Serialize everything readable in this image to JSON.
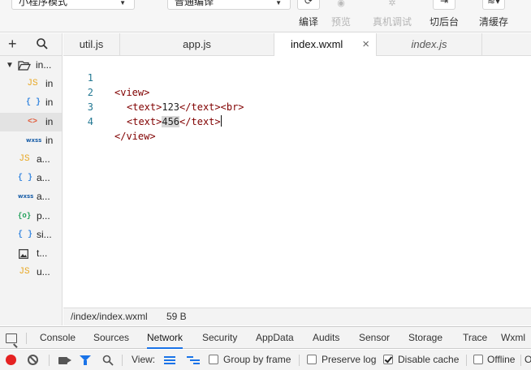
{
  "toolbar": {
    "mode_select": "小程序模式",
    "compile_select": "普通编译",
    "buttons": [
      {
        "label": "编译",
        "icon": "refresh-icon"
      },
      {
        "label": "预览",
        "icon": "eye-icon"
      },
      {
        "label": "真机调试",
        "icon": "bug-icon"
      },
      {
        "label": "切后台",
        "icon": "switch-background-icon"
      },
      {
        "label": "清缓存",
        "icon": "layers-icon"
      }
    ]
  },
  "sidebar": {
    "items": [
      {
        "label": "in...",
        "icon": "folder-open-icon"
      },
      {
        "label": "in",
        "icon": "js-file-icon"
      },
      {
        "label": "in",
        "icon": "json-file-icon"
      },
      {
        "label": "in",
        "icon": "wxml-file-icon"
      },
      {
        "label": "in",
        "icon": "wxss-file-icon"
      },
      {
        "label": "a...",
        "icon": "js-file-icon"
      },
      {
        "label": "a...",
        "icon": "json-file-icon"
      },
      {
        "label": "a...",
        "icon": "wxss-file-icon"
      },
      {
        "label": "p...",
        "icon": "project-config-icon"
      },
      {
        "label": "si...",
        "icon": "json-file-icon"
      },
      {
        "label": "t...",
        "icon": "image-file-icon"
      },
      {
        "label": "u...",
        "icon": "js-file-icon"
      }
    ]
  },
  "tabs": [
    {
      "label": "util.js"
    },
    {
      "label": "app.js"
    },
    {
      "label": "index.wxml"
    },
    {
      "label": "index.js"
    }
  ],
  "editor": {
    "lines": [
      {
        "num": "1",
        "a": "<view>"
      },
      {
        "num": "2",
        "a": "<text>",
        "b": "123",
        "c": "</text><br>"
      },
      {
        "num": "3",
        "a": "<text>",
        "b": "456",
        "c": "</text",
        "d": ">"
      },
      {
        "num": "4",
        "a": "</view>"
      }
    ]
  },
  "status": {
    "path": "/index/index.wxml",
    "size": "59 B"
  },
  "devtools": {
    "tabs": [
      "Console",
      "Sources",
      "Network",
      "Security",
      "AppData",
      "Audits",
      "Sensor",
      "Storage",
      "Trace",
      "Wxml"
    ],
    "active_tab": "Network",
    "view_label": "View:",
    "group_by_frame": "Group by frame",
    "preserve_log": "Preserve log",
    "disable_cache": "Disable cache",
    "offline": "Offline",
    "online_cut": "O"
  },
  "colors": {
    "accent": "#1a73e8",
    "record": "#e52222",
    "line_number": "#237893",
    "tag": "#800000"
  }
}
